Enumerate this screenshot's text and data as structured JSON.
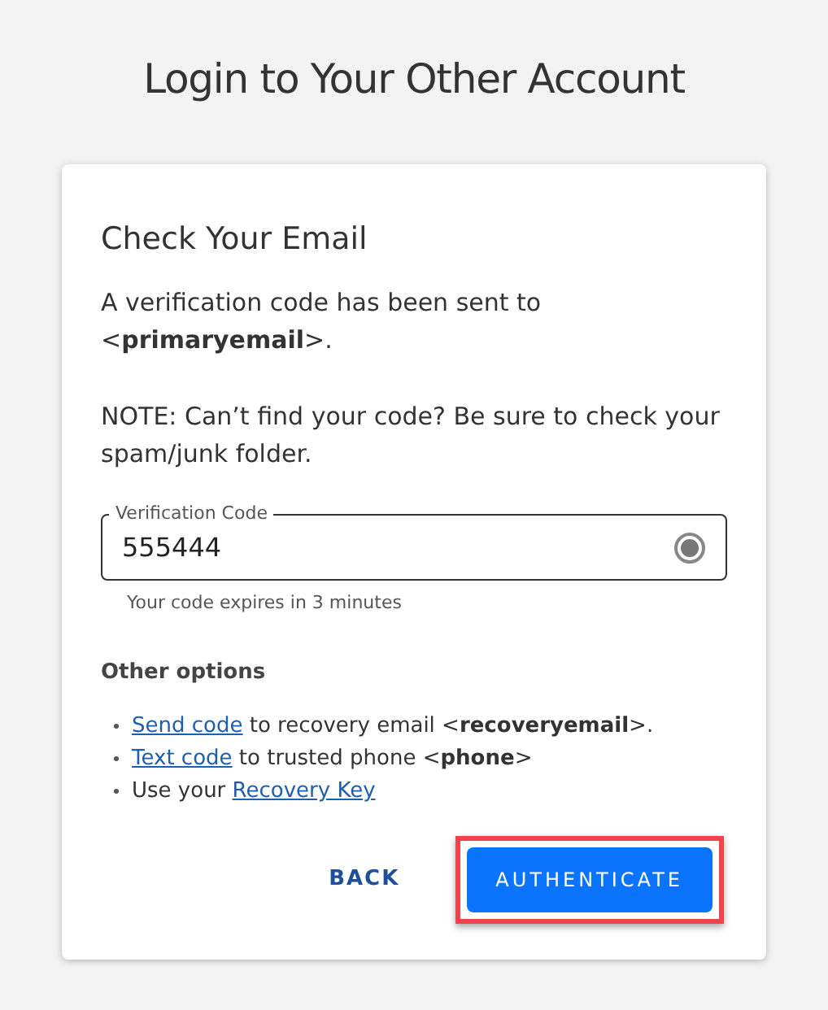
{
  "page_title": "Login to Your Other Account",
  "card": {
    "heading": "Check Your Email",
    "message": "A verification code has been sent to <**primaryemail**>.",
    "note": "NOTE: Can’t find your code? Be sure to check your spam/junk folder.",
    "code_field": {
      "label": "Verification Code",
      "value": "555444",
      "hint": "Your code expires in 3 minutes"
    },
    "options_heading": "Other options",
    "options": [
      {
        "link": "Send code",
        "after": " to recovery email <**recoveryemail**>."
      },
      {
        "link": "Text code",
        "after": " to trusted phone <**phone**>"
      },
      {
        "before": "Use your ",
        "link": "Recovery Key"
      }
    ],
    "buttons": [
      {
        "label": "BACK",
        "kind": "text",
        "highlighted": false
      },
      {
        "label": "AUTHENTICATE",
        "kind": "primary",
        "highlighted": true
      }
    ]
  }
}
